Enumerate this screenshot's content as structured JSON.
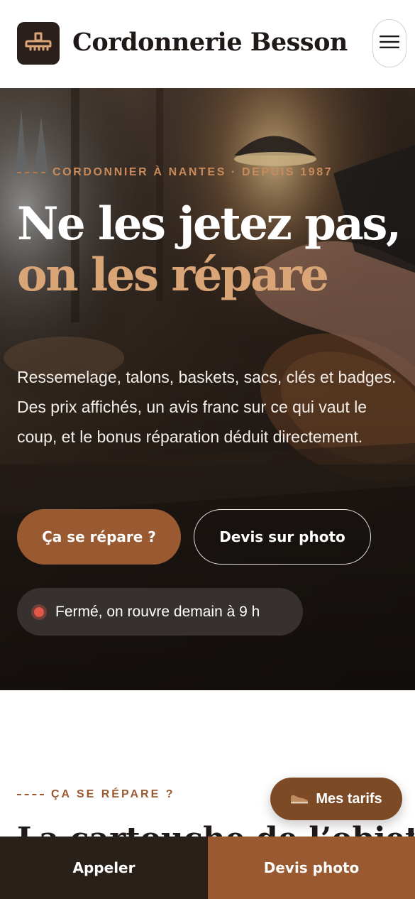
{
  "header": {
    "brand": "Cordonnerie Besson",
    "logo_icon": "shoe-brush-icon",
    "menu_icon": "hamburger-icon"
  },
  "hero": {
    "eyebrow": "CORDONNIER À NANTES · DEPUIS 1987",
    "title_part1": "Ne les jetez pas, ",
    "title_accent": "on les répare",
    "description": "Ressemelage, talons, baskets, sacs, clés et badges. Des prix affichés, un avis franc sur ce qui vaut le coup, et le bonus réparation déduit directement.",
    "primary_button": "Ça se répare ?",
    "secondary_button": "Devis sur photo",
    "status_text": "Fermé, on rouvre demain à 9 h"
  },
  "section": {
    "eyebrow": "ÇA SE RÉPARE ?",
    "title_peek": "La cartouche de l’objet"
  },
  "fab": {
    "label": "Mes tarifs",
    "icon": "shoe-icon"
  },
  "bottom_bar": {
    "call": "Appeler",
    "quote": "Devis photo"
  },
  "colors": {
    "accent": "#9a5a31",
    "accent_light": "#d9a476",
    "dark": "#2a201a",
    "status_closed": "#e0584a"
  }
}
